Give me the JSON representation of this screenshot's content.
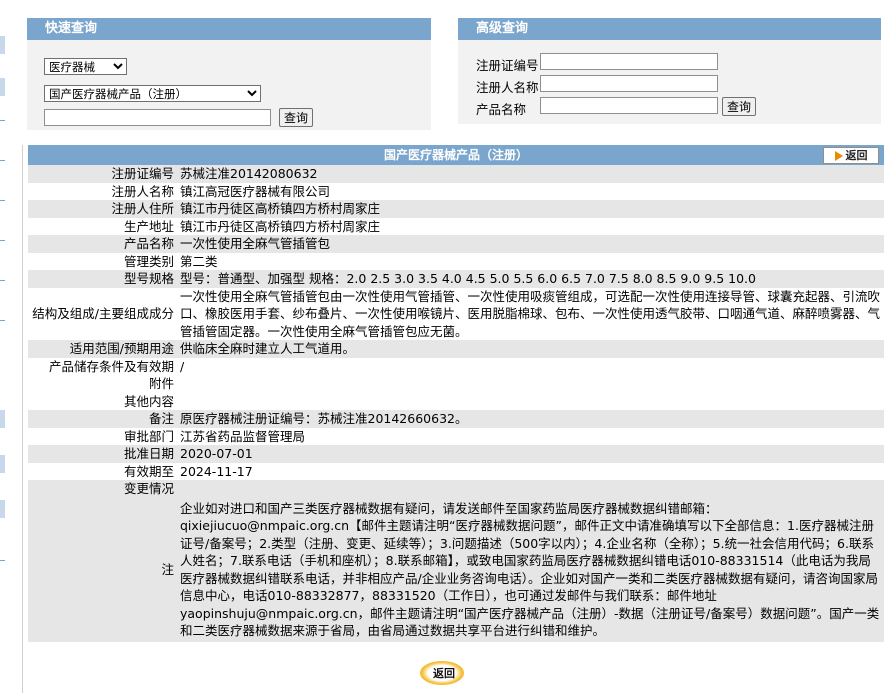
{
  "quick_search": {
    "title": "快速查询",
    "category_select": "医疗器械",
    "database_select": "国产医疗器械产品（注册）",
    "keyword_value": "",
    "button": "查询"
  },
  "advanced_search": {
    "title": "高级查询",
    "fields": [
      {
        "label": "注册证编号",
        "value": ""
      },
      {
        "label": "注册人名称",
        "value": ""
      },
      {
        "label": "产品名称",
        "value": ""
      }
    ],
    "button": "查询"
  },
  "detail": {
    "title": "国产医疗器械产品（注册）",
    "back_label": "返回",
    "rows": [
      {
        "label": "注册证编号",
        "value": "苏械注准20142080632"
      },
      {
        "label": "注册人名称",
        "value": "镇江高冠医疗器械有限公司"
      },
      {
        "label": "注册人住所",
        "value": "镇江市丹徒区高桥镇四方桥村周家庄"
      },
      {
        "label": "生产地址",
        "value": "镇江市丹徒区高桥镇四方桥村周家庄"
      },
      {
        "label": "产品名称",
        "value": "一次性使用全麻气管插管包"
      },
      {
        "label": "管理类别",
        "value": "第二类"
      },
      {
        "label": "型号规格",
        "value": "型号：普通型、加强型 规格：2.0 2.5 3.0 3.5 4.0 4.5 5.0 5.5 6.0 6.5 7.0 7.5 8.0 8.5 9.0 9.5 10.0"
      },
      {
        "label": "结构及组成/主要组成成分",
        "value": "一次性使用全麻气管插管包由一次性使用气管插管、一次性使用吸痰管组成，可选配一次性使用连接导管、球囊充起器、引流吹口、橡胶医用手套、纱布叠片、一次性使用喉镜片、医用脱脂棉球、包布、一次性使用透气胶带、口咽通气道、麻醉喷雾器、气管插管固定器。一次性使用全麻气管插管包应无菌。"
      },
      {
        "label": "适用范围/预期用途",
        "value": "供临床全麻时建立人工气道用。"
      },
      {
        "label": "产品储存条件及有效期",
        "value": "/"
      },
      {
        "label": "附件",
        "value": ""
      },
      {
        "label": "其他内容",
        "value": ""
      },
      {
        "label": "备注",
        "value": "原医疗器械注册证编号：苏械注准20142660632。"
      },
      {
        "label": "审批部门",
        "value": "江苏省药品监督管理局"
      },
      {
        "label": "批准日期",
        "value": "2020-07-01"
      },
      {
        "label": "有效期至",
        "value": "2024-11-17"
      },
      {
        "label": "变更情况",
        "value": ""
      }
    ],
    "note_label": "注",
    "note": "企业如对进口和国产三类医疗器械数据有疑问，请发送邮件至国家药监局医疗器械数据纠错邮箱：qixiejiucuo@nmpaic.org.cn【邮件主题请注明“医疗器械数据问题”，邮件正文中请准确填写以下全部信息：1.医疗器械注册证号/备案号；2.类型（注册、变更、延续等）；3.问题描述（500字以内）；4.企业名称（全称）；5.统一社会信用代码；6.联系人姓名；7.联系电话（手机和座机）；8.联系邮箱】，或致电国家药监局医疗器械数据纠错电话010-88331514（此电话为我局医疗器械数据纠错联系电话，并非相应产品/企业业务咨询电话）。企业如对国产一类和二类医疗器械数据有疑问，请咨询国家局信息中心，电话010-88332877，88331520（工作日），也可通过发邮件与我们联系：邮件地址yaopinshuju@nmpaic.org.cn，邮件主题请注明“国产医疗器械产品（注册）-数据（注册证号/备案号）数据问题”。国产一类和二类医疗器械数据来源于省局，由省局通过数据共享平台进行纠错和维护。",
    "bottom_back_label": "返回"
  }
}
